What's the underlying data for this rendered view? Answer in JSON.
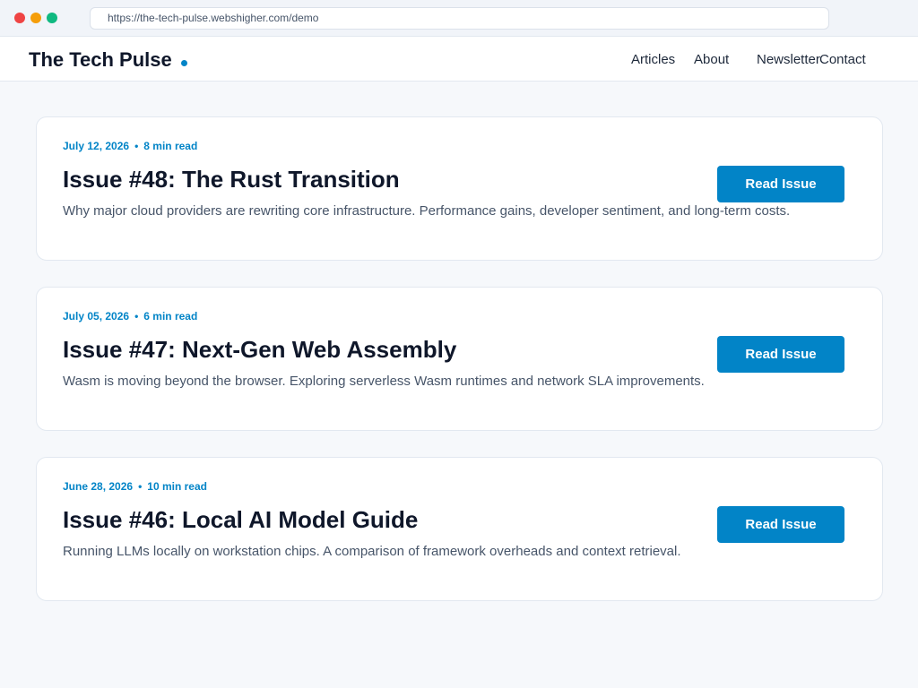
{
  "browser": {
    "url": "https://the-tech-pulse.webshigher.com/demo"
  },
  "header": {
    "logo": "The Tech Pulse",
    "nav": [
      "Articles",
      "About",
      "Newsletter",
      "Contact"
    ]
  },
  "issues": [
    {
      "date": "July 12, 2026",
      "read_time": "8 min read",
      "title": "Issue #48: The Rust Transition",
      "description": "Why major cloud providers are rewriting core infrastructure. Performance gains, developer sentiment, and long-term costs.",
      "button": "Read Issue"
    },
    {
      "date": "July 05, 2026",
      "read_time": "6 min read",
      "title": "Issue #47: Next-Gen Web Assembly",
      "description": "Wasm is moving beyond the browser. Exploring serverless Wasm runtimes and network SLA improvements.",
      "button": "Read Issue"
    },
    {
      "date": "June 28, 2026",
      "read_time": "10 min read",
      "title": "Issue #46: Local AI Model Guide",
      "description": "Running LLMs locally on workstation chips. A comparison of framework overheads and context retrieval.",
      "button": "Read Issue"
    }
  ],
  "colors": {
    "accent": "#0284c7",
    "heading": "#0f172a",
    "body_text": "#475569",
    "background": "#f6f8fb"
  }
}
